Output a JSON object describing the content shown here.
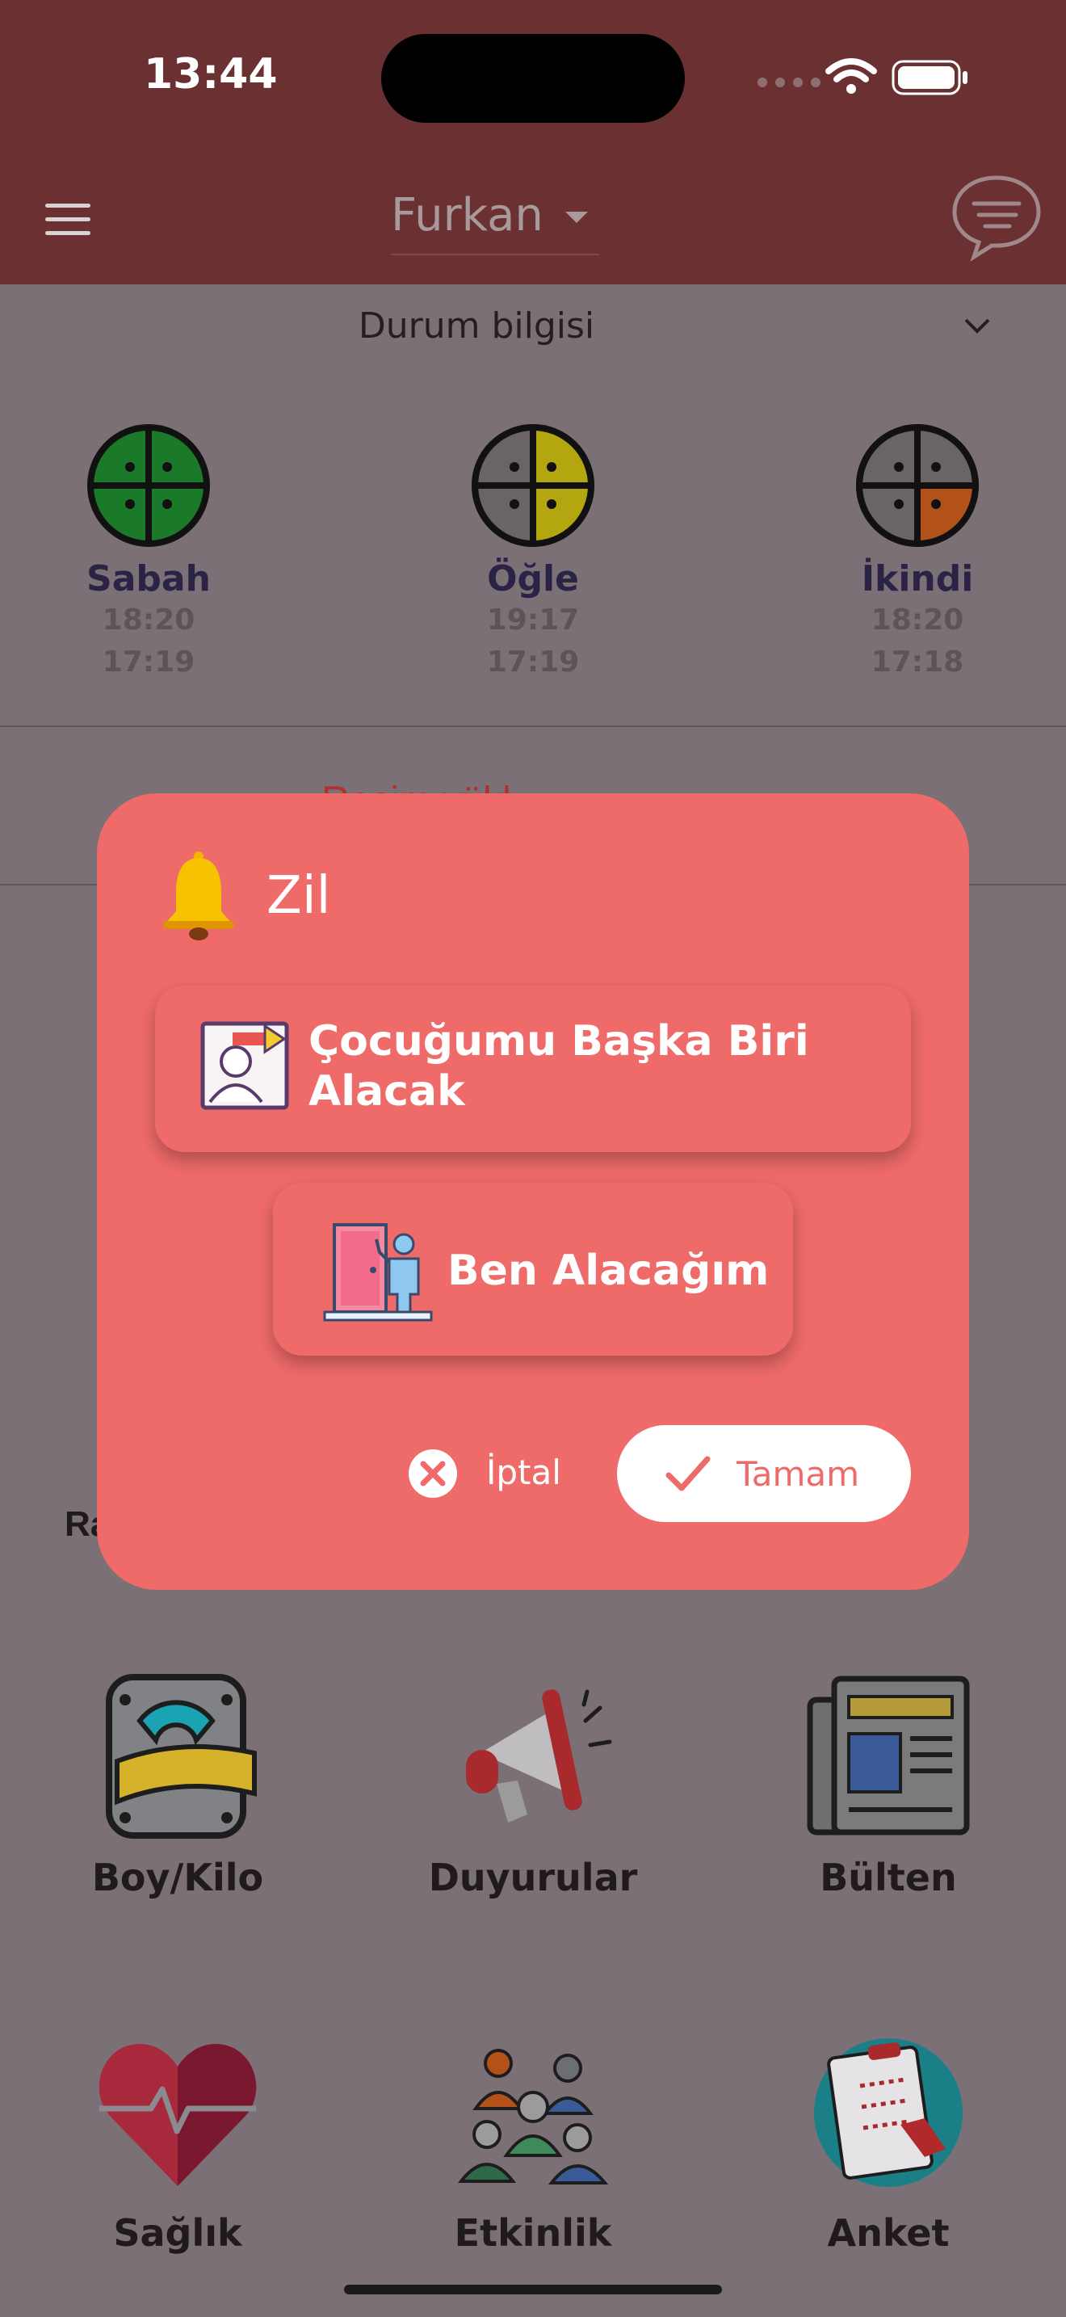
{
  "status_bar": {
    "time": "13:44"
  },
  "header": {
    "child_name": "Furkan",
    "menu_icon": "hamburger-menu-icon",
    "messages_icon": "chat-bubble-icon",
    "colors": {
      "header_bg": "#6b3032"
    }
  },
  "status_section": {
    "title": "Durum bilgisi",
    "periods": [
      {
        "name": "Sabah",
        "time1": "18:20",
        "time2": "17:19"
      },
      {
        "name": "Öğle",
        "time1": "19:17",
        "time2": "17:19"
      },
      {
        "name": "İkindi",
        "time1": "18:20",
        "time2": "17:18"
      }
    ]
  },
  "obscured_text": {
    "red_line": "Resim yükl…",
    "ra": "Ra"
  },
  "tiles": [
    {
      "label": "Boy/Kilo",
      "icon": "weight-scale-icon"
    },
    {
      "label": "Duyurular",
      "icon": "megaphone-icon"
    },
    {
      "label": "Bülten",
      "icon": "newspaper-icon"
    },
    {
      "label": "Sağlık",
      "icon": "heart-pulse-icon"
    },
    {
      "label": "Etkinlik",
      "icon": "group-people-icon"
    },
    {
      "label": "Anket",
      "icon": "survey-clipboard-icon"
    }
  ],
  "dialog": {
    "title": "Zil",
    "icon": "bell-icon",
    "options": [
      {
        "label": "Çocuğumu Başka Biri Alacak",
        "icon": "person-pickup-icon"
      },
      {
        "label": "Ben Alacağım",
        "icon": "door-person-icon"
      }
    ],
    "cancel_label": "İptal",
    "ok_label": "Tamam",
    "colors": {
      "dialog_bg": "#ef6b69",
      "ok_text": "#ef6b69"
    }
  }
}
